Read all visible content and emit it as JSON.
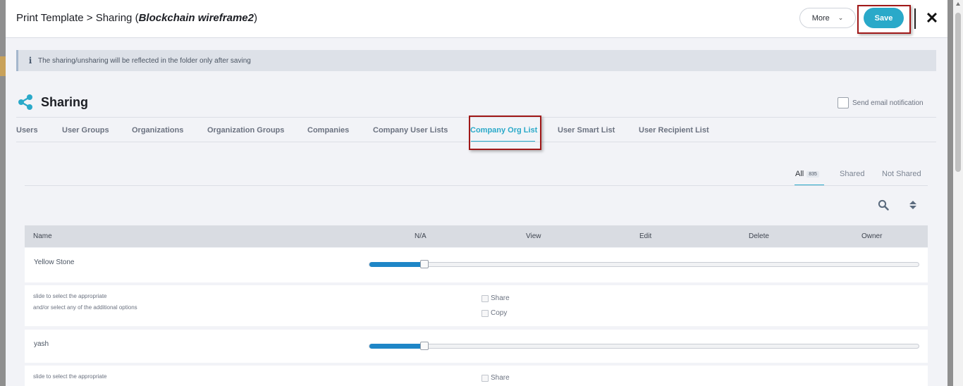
{
  "header": {
    "title_prefix": "Print Template > Sharing (",
    "title_name": "Blockchain wireframe2",
    "title_suffix": ")",
    "more_label": "More",
    "save_label": "Save",
    "close_label": "✕"
  },
  "banner": {
    "text": "The sharing/unsharing will be reflected in the folder only after saving",
    "icon": "info-icon"
  },
  "section": {
    "title": "Sharing",
    "icon": "share-icon",
    "email_notification_label": "Send email notification"
  },
  "tabs": [
    {
      "label": "Users",
      "active": false
    },
    {
      "label": "User Groups",
      "active": false
    },
    {
      "label": "Organizations",
      "active": false
    },
    {
      "label": "Organization Groups",
      "active": false
    },
    {
      "label": "Companies",
      "active": false
    },
    {
      "label": "Company User Lists",
      "active": false
    },
    {
      "label": "Company Org List",
      "active": true
    },
    {
      "label": "User Smart List",
      "active": false
    },
    {
      "label": "User Recipient List",
      "active": false
    }
  ],
  "filters": {
    "all_label": "All",
    "all_count": "835",
    "shared_label": "Shared",
    "not_shared_label": "Not Shared",
    "active": "All"
  },
  "table": {
    "columns": [
      "Name",
      "N/A",
      "View",
      "Edit",
      "Delete",
      "Owner"
    ],
    "rows": [
      {
        "name": "Yellow Stone",
        "permission_level": "N/A",
        "hint_line1": "slide to select the appropriate",
        "hint_line2": "and/or select any of the additional options",
        "options": [
          "Share",
          "Copy"
        ]
      },
      {
        "name": "yash",
        "permission_level": "N/A",
        "hint_line1": "slide to select the appropriate",
        "options": [
          "Share"
        ]
      }
    ]
  },
  "colors": {
    "accent": "#2aa9c9",
    "slider_fill": "#1e86c7",
    "highlight_box": "#a01818"
  }
}
